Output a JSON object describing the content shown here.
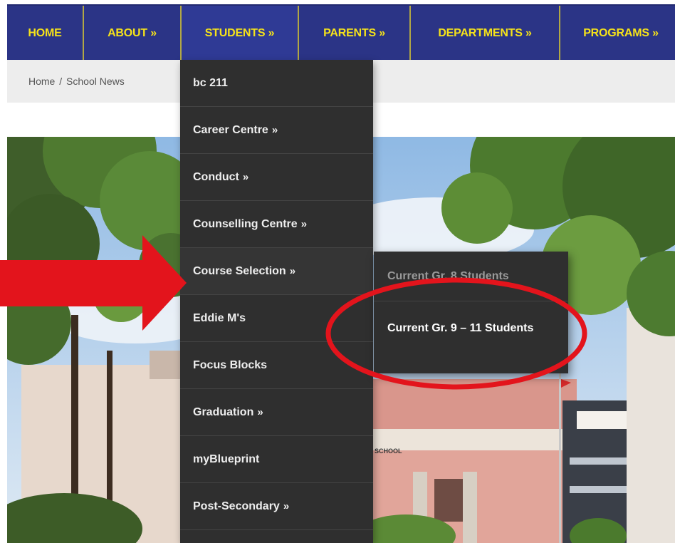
{
  "nav": {
    "items": [
      {
        "label": "HOME"
      },
      {
        "label": "ABOUT »"
      },
      {
        "label": "STUDENTS »"
      },
      {
        "label": "PARENTS »"
      },
      {
        "label": "DEPARTMENTS »"
      },
      {
        "label": "PROGRAMS »"
      }
    ]
  },
  "breadcrumb": {
    "home": "Home",
    "separator": "/",
    "current": "School News"
  },
  "dropdown": {
    "items": [
      {
        "label": "bc 211",
        "arrow": ""
      },
      {
        "label": "Career Centre",
        "arrow": "»"
      },
      {
        "label": "Conduct",
        "arrow": "»"
      },
      {
        "label": "Counselling Centre",
        "arrow": "»"
      },
      {
        "label": "Course Selection",
        "arrow": "»"
      },
      {
        "label": "Eddie M's",
        "arrow": ""
      },
      {
        "label": "Focus Blocks",
        "arrow": ""
      },
      {
        "label": "Graduation",
        "arrow": "»"
      },
      {
        "label": "myBlueprint",
        "arrow": ""
      },
      {
        "label": "Post-Secondary",
        "arrow": "»"
      }
    ]
  },
  "submenu": {
    "items": [
      {
        "label": "Current Gr. 8 Students"
      },
      {
        "label": "Current Gr. 9 – 11 Students"
      }
    ]
  },
  "hero": {
    "building_sign": "SCHOOL"
  },
  "colors": {
    "nav_bg": "#2b3486",
    "nav_text": "#f5e21a",
    "menu_bg": "#2f2f2f",
    "annotation_red": "#e3141c"
  }
}
